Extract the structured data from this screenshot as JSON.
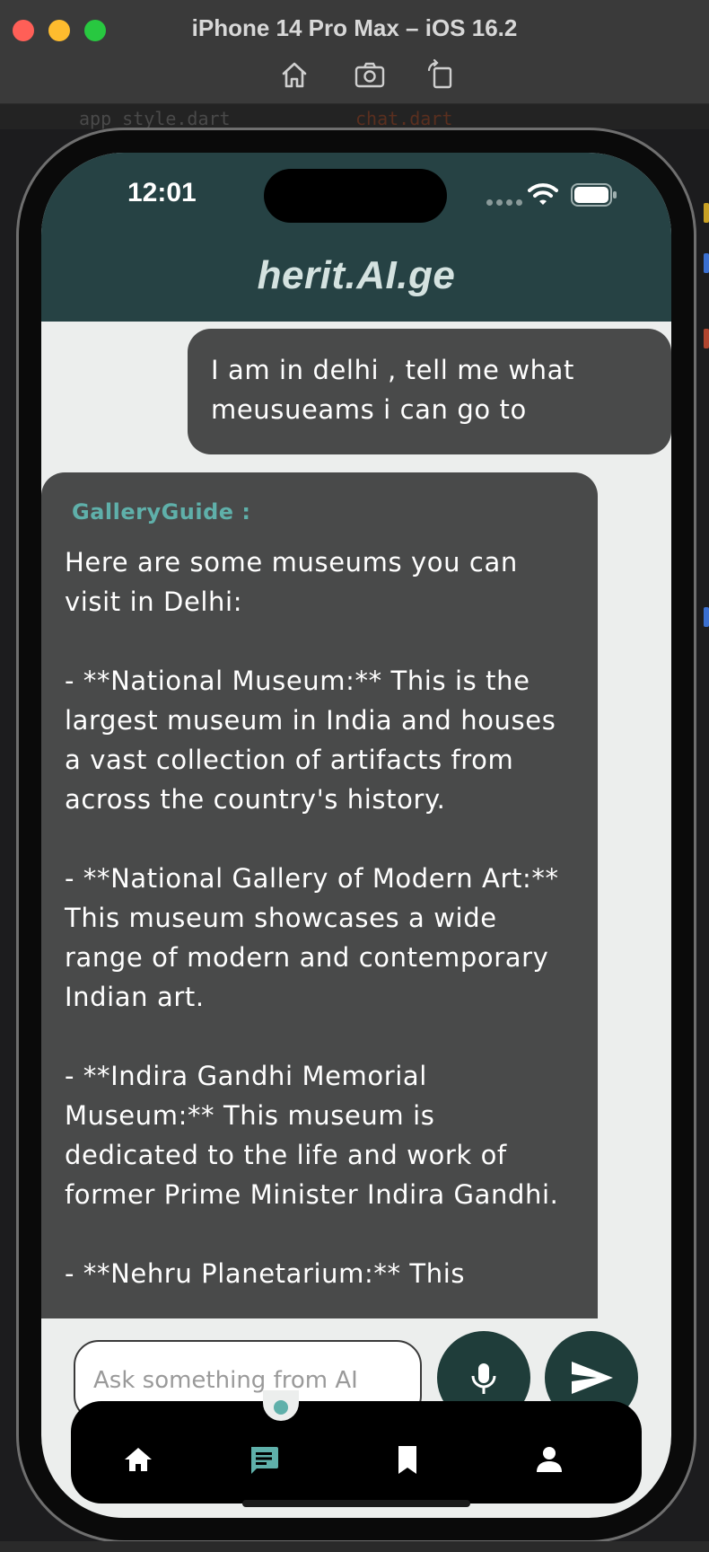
{
  "simulator": {
    "title": "iPhone 14 Pro Max – iOS 16.2",
    "tools": [
      "home-icon",
      "screenshot-icon",
      "rotate-icon"
    ]
  },
  "ide": {
    "tab1": "app_style.dart",
    "tab2": "chat.dart"
  },
  "status_bar": {
    "time": "12:01"
  },
  "header": {
    "title": "herit.AI.ge"
  },
  "chat": {
    "user_message": "I am in delhi , tell me what meusueams i can go to",
    "ai_sender": "GalleryGuide :",
    "ai_message": "Here are some museums you can visit in Delhi:\n\n- **National Museum:** This is the largest museum in India and houses a vast collection of artifacts from across the country's history.\n\n- **National Gallery of Modern Art:** This museum showcases a wide range of modern and contemporary Indian art.\n\n- **Indira Gandhi Memorial Museum:** This museum is dedicated to the life and work of former Prime Minister Indira Gandhi.\n\n- **Nehru Planetarium:** This"
  },
  "input": {
    "placeholder": "Ask something from AI"
  },
  "nav": {
    "items": [
      "home-icon",
      "chat-icon",
      "bookmark-icon",
      "profile-icon"
    ],
    "active": "chat-icon"
  },
  "colors": {
    "header": "#264244",
    "bubble": "#494a4a",
    "accent": "#5fb0aa",
    "button": "#1f3d3a",
    "screen_bg": "#eceeed",
    "nav_bg": "#000000"
  }
}
